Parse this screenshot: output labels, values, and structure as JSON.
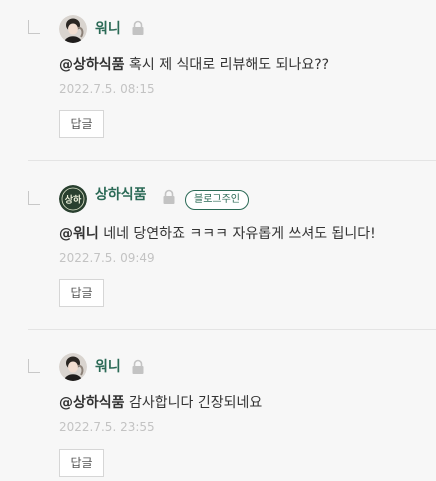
{
  "comments": [
    {
      "author": "워니",
      "mention": "@상하식품",
      "text": " 혹시 제 식대로 리뷰해도 되나요??",
      "date": "2022.7.5. 08:15",
      "reply_label": "답글",
      "avatar_icon": "user-avatar-photo",
      "lock_icon": "lock-icon"
    },
    {
      "author": "상하식품",
      "badge": "블로그주인",
      "mention": "@워니",
      "text": " 네네 당연하죠 ㅋㅋㅋ 자유롭게 쓰셔도 됩니다!",
      "date": "2022.7.5. 09:49",
      "reply_label": "답글",
      "avatar_icon": "blog-logo-avatar",
      "lock_icon": "lock-icon"
    },
    {
      "author": "워니",
      "mention": "@상하식품",
      "text": " 감사합니다 긴장되네요",
      "date": "2022.7.5. 23:55",
      "reply_label": "답글",
      "avatar_icon": "user-avatar-photo",
      "lock_icon": "lock-icon"
    }
  ],
  "colors": {
    "author": "#2b6a56",
    "date": "#c3c3c3",
    "background": "#f7f7f7",
    "divider": "#e4e4e4"
  }
}
